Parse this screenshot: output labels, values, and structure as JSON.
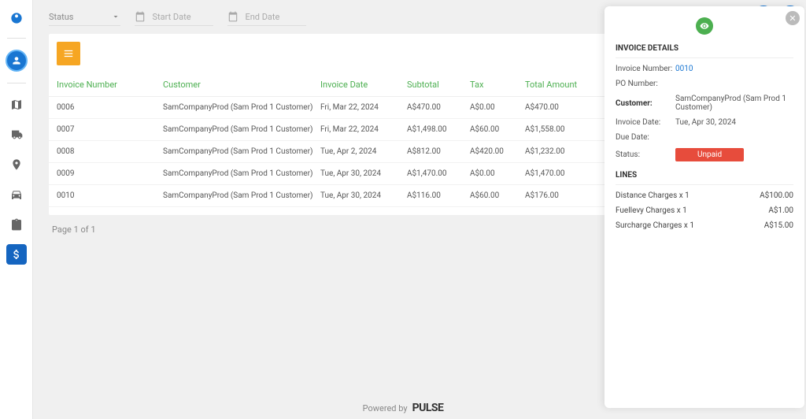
{
  "filters": {
    "status_label": "Status",
    "start_placeholder": "Start Date",
    "end_placeholder": "End Date"
  },
  "columns": {
    "invoice": "Invoice Number",
    "customer": "Customer",
    "date": "Invoice Date",
    "subtotal": "Subtotal",
    "tax": "Tax",
    "total": "Total Amount"
  },
  "rows": [
    {
      "no": "0006",
      "cust": "SamCompanyProd (Sam Prod 1 Customer)",
      "date": "Fri, Mar 22, 2024",
      "sub": "A$470.00",
      "tax": "A$0.00",
      "tot": "A$470.00"
    },
    {
      "no": "0007",
      "cust": "SamCompanyProd (Sam Prod 1 Customer)",
      "date": "Fri, Mar 22, 2024",
      "sub": "A$1,498.00",
      "tax": "A$60.00",
      "tot": "A$1,558.00"
    },
    {
      "no": "0008",
      "cust": "SamCompanyProd (Sam Prod 1 Customer)",
      "date": "Tue, Apr 2, 2024",
      "sub": "A$812.00",
      "tax": "A$420.00",
      "tot": "A$1,232.00"
    },
    {
      "no": "0009",
      "cust": "SamCompanyProd (Sam Prod 1 Customer)",
      "date": "Tue, Apr 30, 2024",
      "sub": "A$1,470.00",
      "tax": "A$0.00",
      "tot": "A$1,470.00"
    },
    {
      "no": "0010",
      "cust": "SamCompanyProd (Sam Prod 1 Customer)",
      "date": "Tue, Apr 30, 2024",
      "sub": "A$116.00",
      "tax": "A$60.00",
      "tot": "A$176.00"
    }
  ],
  "pagination": "Page 1 of 1",
  "footer": {
    "powered": "Powered by",
    "brand": "PULSE"
  },
  "detail": {
    "heading": "INVOICE DETAILS",
    "invoice_no_label": "Invoice Number:",
    "invoice_no": "0010",
    "po_label": "PO Number:",
    "po": "",
    "customer_label": "Customer:",
    "customer": "SamCompanyProd (Sam Prod 1 Customer)",
    "date_label": "Invoice Date:",
    "date": "Tue, Apr 30, 2024",
    "due_label": "Due Date:",
    "due": "",
    "status_label": "Status:",
    "status": "Unpaid",
    "lines_heading": "LINES",
    "lines": [
      {
        "label": "Distance Charges x 1",
        "amount": "A$100.00"
      },
      {
        "label": "Fuellevy Charges x 1",
        "amount": "A$1.00"
      },
      {
        "label": "Surcharge Charges x 1",
        "amount": "A$15.00"
      }
    ]
  }
}
